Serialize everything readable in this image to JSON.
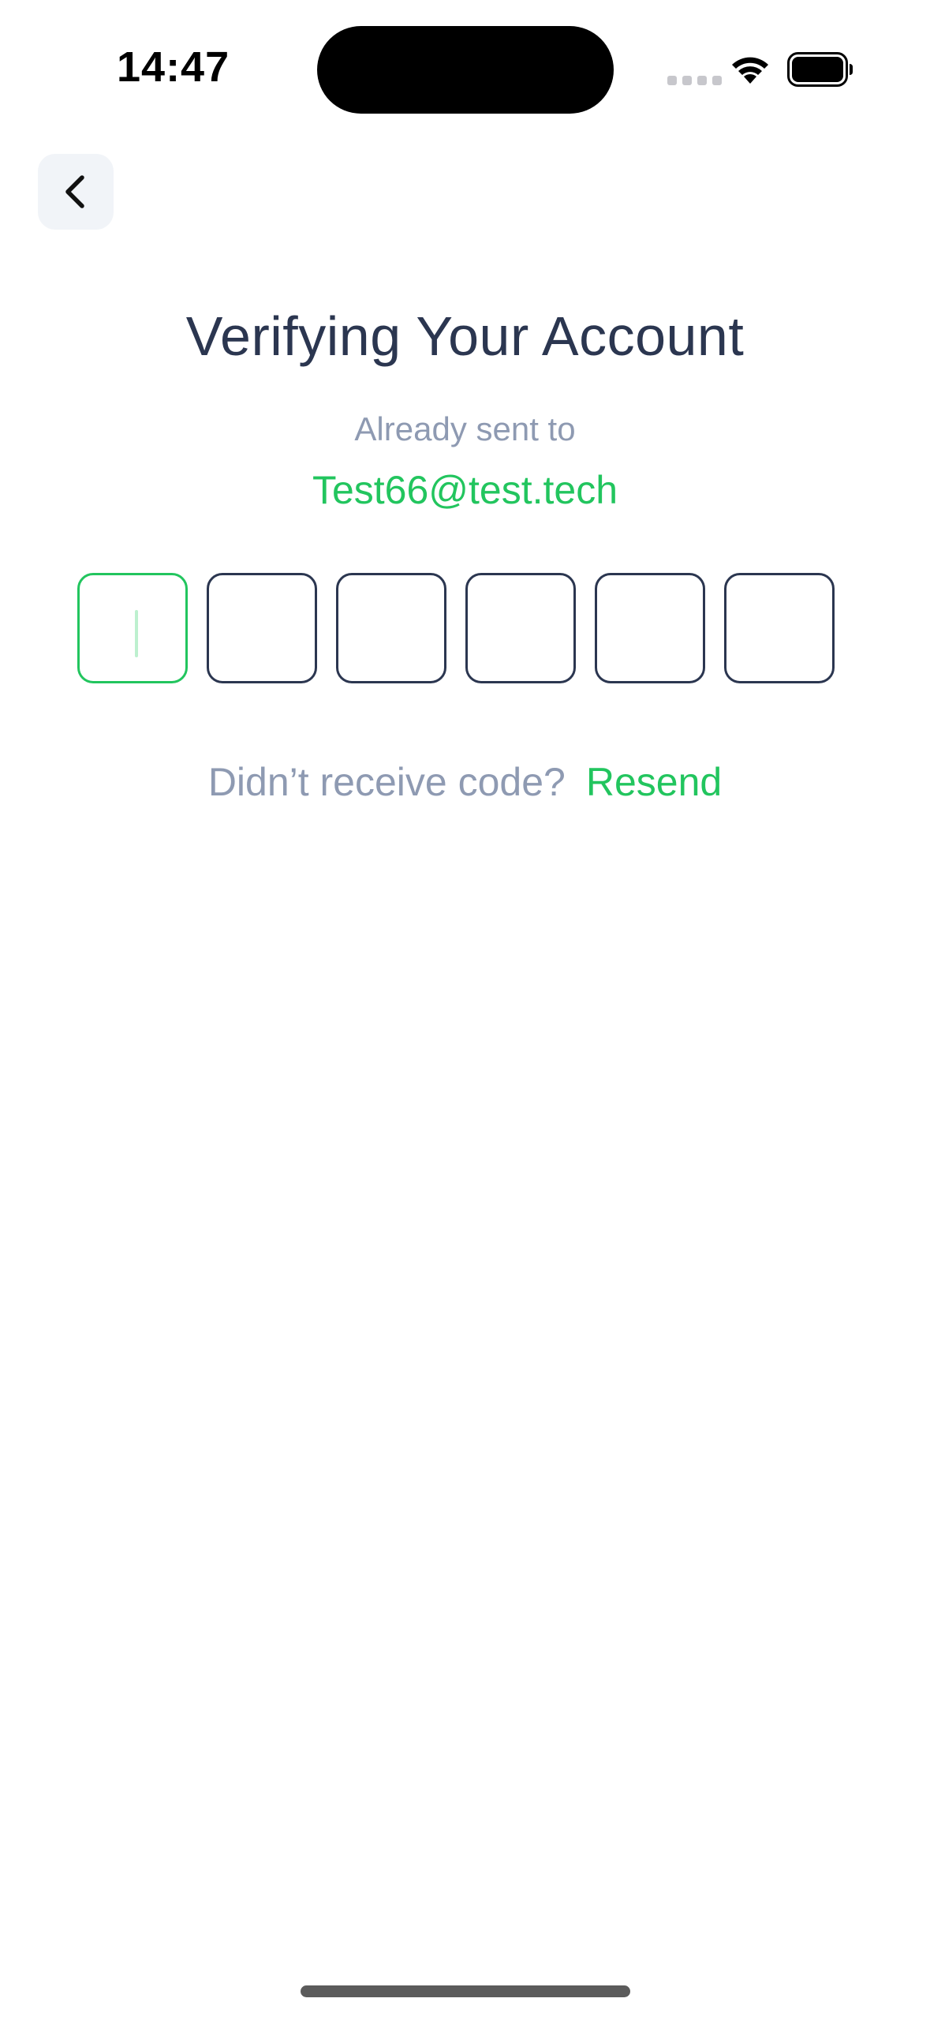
{
  "status_bar": {
    "time": "14:47",
    "wifi_icon": "wifi-icon",
    "battery_icon": "battery-full-icon"
  },
  "header": {
    "back_icon": "chevron-left-icon"
  },
  "main": {
    "title": "Verifying Your Account",
    "sent_label": "Already sent to",
    "email": "Test66@test.tech",
    "code_boxes": [
      "",
      "",
      "",
      "",
      "",
      ""
    ],
    "active_box_index": 0,
    "resend_prompt": "Didn’t receive code?",
    "resend_label": "Resend"
  },
  "colors": {
    "accent": "#22c55e",
    "title": "#2b3650",
    "muted": "#8e9ab2",
    "back_button_bg": "#f1f4f8"
  }
}
